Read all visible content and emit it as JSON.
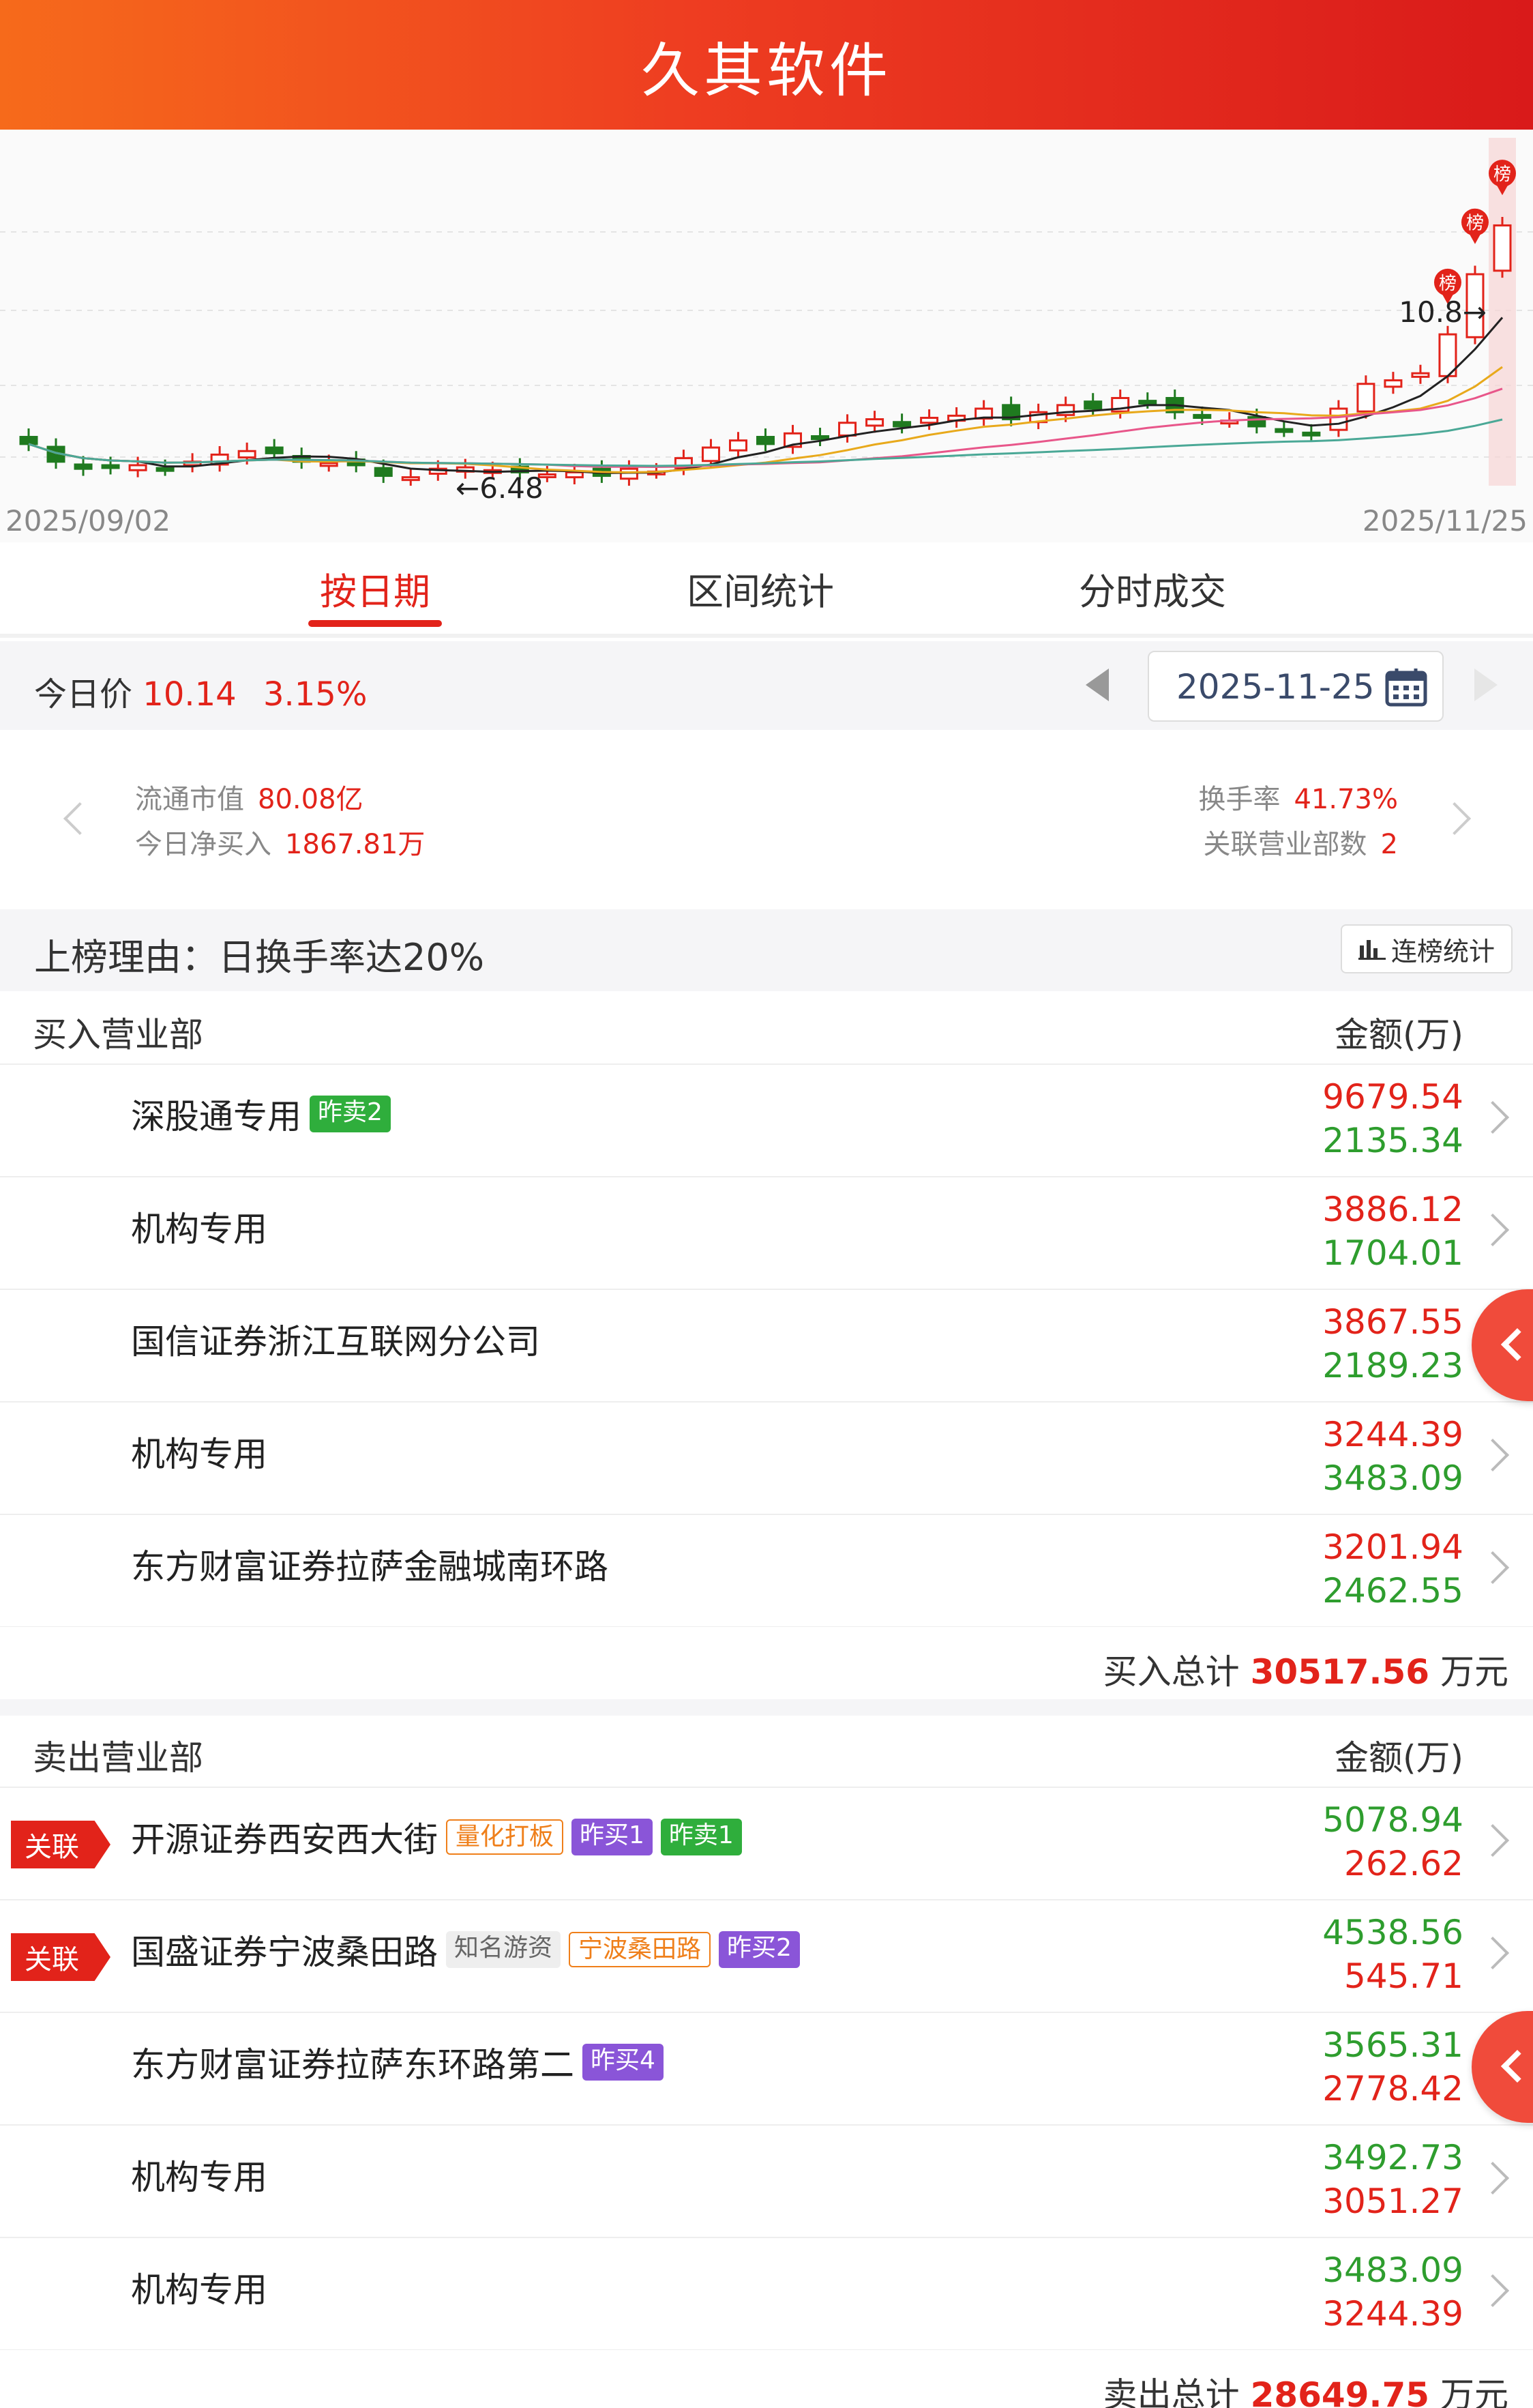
{
  "header": {
    "title": "久其软件"
  },
  "chart": {
    "start_date": "2025/09/02",
    "end_date": "2025/11/25",
    "low_label": "←6.48",
    "high_label": "10.8→",
    "marker_label": "榜"
  },
  "chart_data": {
    "type": "candlestick",
    "x_range": [
      "2025/09/02",
      "2025/11/25"
    ],
    "y_range": [
      6.48,
      10.8
    ],
    "annotations": [
      {
        "text": "6.48",
        "kind": "low"
      },
      {
        "text": "10.8",
        "kind": "high"
      }
    ],
    "markers": [
      "榜",
      "榜",
      "榜"
    ],
    "colors": {
      "up": "#e2231a",
      "down": "#1f7a1f",
      "ma5": "#222222",
      "ma10": "#e8a91b",
      "ma20": "#e8568a",
      "ma60": "#4aa896"
    }
  },
  "tabs": [
    {
      "label": "按日期"
    },
    {
      "label": "区间统计"
    },
    {
      "label": "分时成交"
    }
  ],
  "price": {
    "label": "今日价",
    "value": "10.14",
    "change": "3.15%",
    "date": "2025-11-25"
  },
  "stats": {
    "float_cap_label": "流通市值",
    "float_cap": "80.08亿",
    "net_buy_label": "今日净买入",
    "net_buy": "1867.81万",
    "turnover_label": "换手率",
    "turnover": "41.73%",
    "branches_label": "关联营业部数",
    "branches": "2"
  },
  "reason": {
    "text": "上榜理由：日换手率达20%",
    "button": "连榜统计"
  },
  "buy": {
    "header": "买入营业部",
    "amount_header": "金额(万)",
    "rows": [
      {
        "name": "深股通专用",
        "tags": [
          {
            "text": "昨卖2",
            "style": "green"
          }
        ],
        "v1": "9679.54",
        "v2": "2135.34"
      },
      {
        "name": "机构专用",
        "tags": [],
        "v1": "3886.12",
        "v2": "1704.01"
      },
      {
        "name": "国信证券浙江互联网分公司",
        "tags": [],
        "v1": "3867.55",
        "v2": "2189.23"
      },
      {
        "name": "机构专用",
        "tags": [],
        "v1": "3244.39",
        "v2": "3483.09"
      },
      {
        "name": "东方财富证券拉萨金融城南环路",
        "tags": [],
        "v1": "3201.94",
        "v2": "2462.55"
      }
    ],
    "total_label": "买入总计",
    "total": "30517.56",
    "unit": "万元"
  },
  "sell": {
    "header": "卖出营业部",
    "amount_header": "金额(万)",
    "rows": [
      {
        "badge": "关联",
        "name": "开源证券西安西大街",
        "tags": [
          {
            "text": "量化打板",
            "style": "orange"
          },
          {
            "text": "昨买1",
            "style": "purple"
          },
          {
            "text": "昨卖1",
            "style": "green"
          }
        ],
        "v1": "5078.94",
        "v2": "262.62"
      },
      {
        "badge": "关联",
        "name": "国盛证券宁波桑田路",
        "tags": [
          {
            "text": "知名游资",
            "style": "gray"
          },
          {
            "text": "宁波桑田路",
            "style": "orange"
          },
          {
            "text": "昨买2",
            "style": "purple"
          }
        ],
        "v1": "4538.56",
        "v2": "545.71"
      },
      {
        "name": "东方财富证券拉萨东环路第二",
        "tags": [
          {
            "text": "昨买4",
            "style": "purple"
          }
        ],
        "v1": "3565.31",
        "v2": "2778.42"
      },
      {
        "name": "机构专用",
        "tags": [],
        "v1": "3492.73",
        "v2": "3051.27"
      },
      {
        "name": "机构专用",
        "tags": [],
        "v1": "3483.09",
        "v2": "3244.39"
      }
    ],
    "total_label": "卖出总计",
    "total": "28649.75",
    "unit": "万元"
  }
}
